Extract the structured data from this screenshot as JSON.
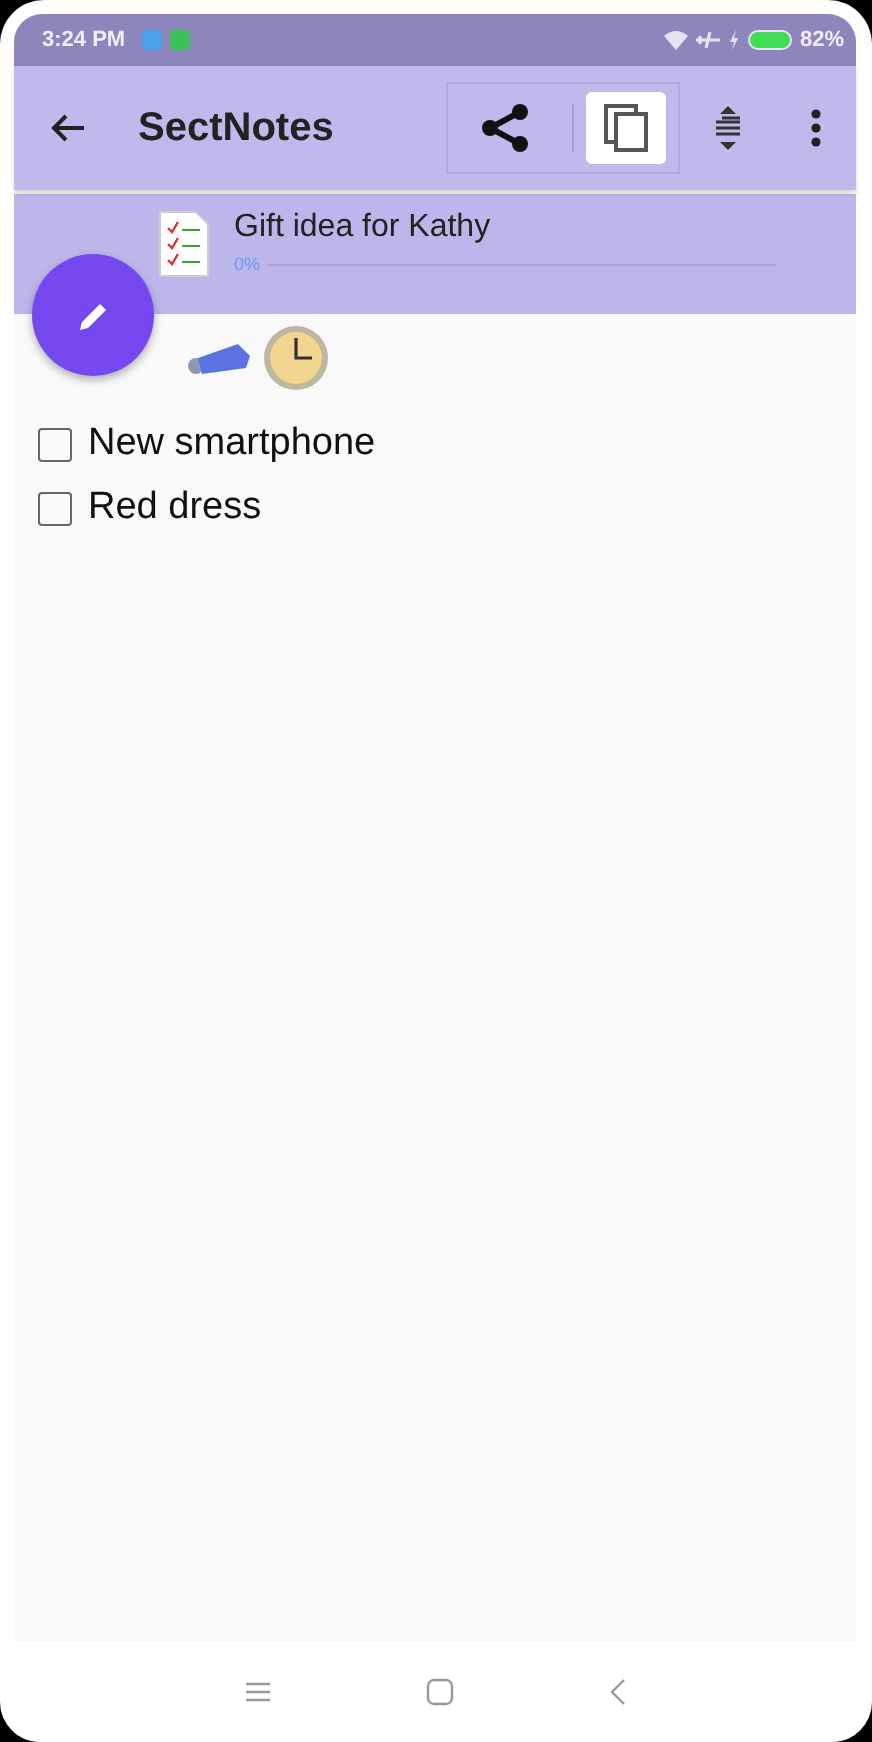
{
  "status_bar": {
    "time": "3:24 PM",
    "battery": "82%"
  },
  "app_bar": {
    "title": "SectNotes"
  },
  "note": {
    "title": "Gift idea for Kathy",
    "progress_label": "0%",
    "level": 0
  },
  "items": [
    {
      "label": "New smartphone",
      "checked": false
    },
    {
      "label": "Red dress",
      "checked": false
    }
  ]
}
